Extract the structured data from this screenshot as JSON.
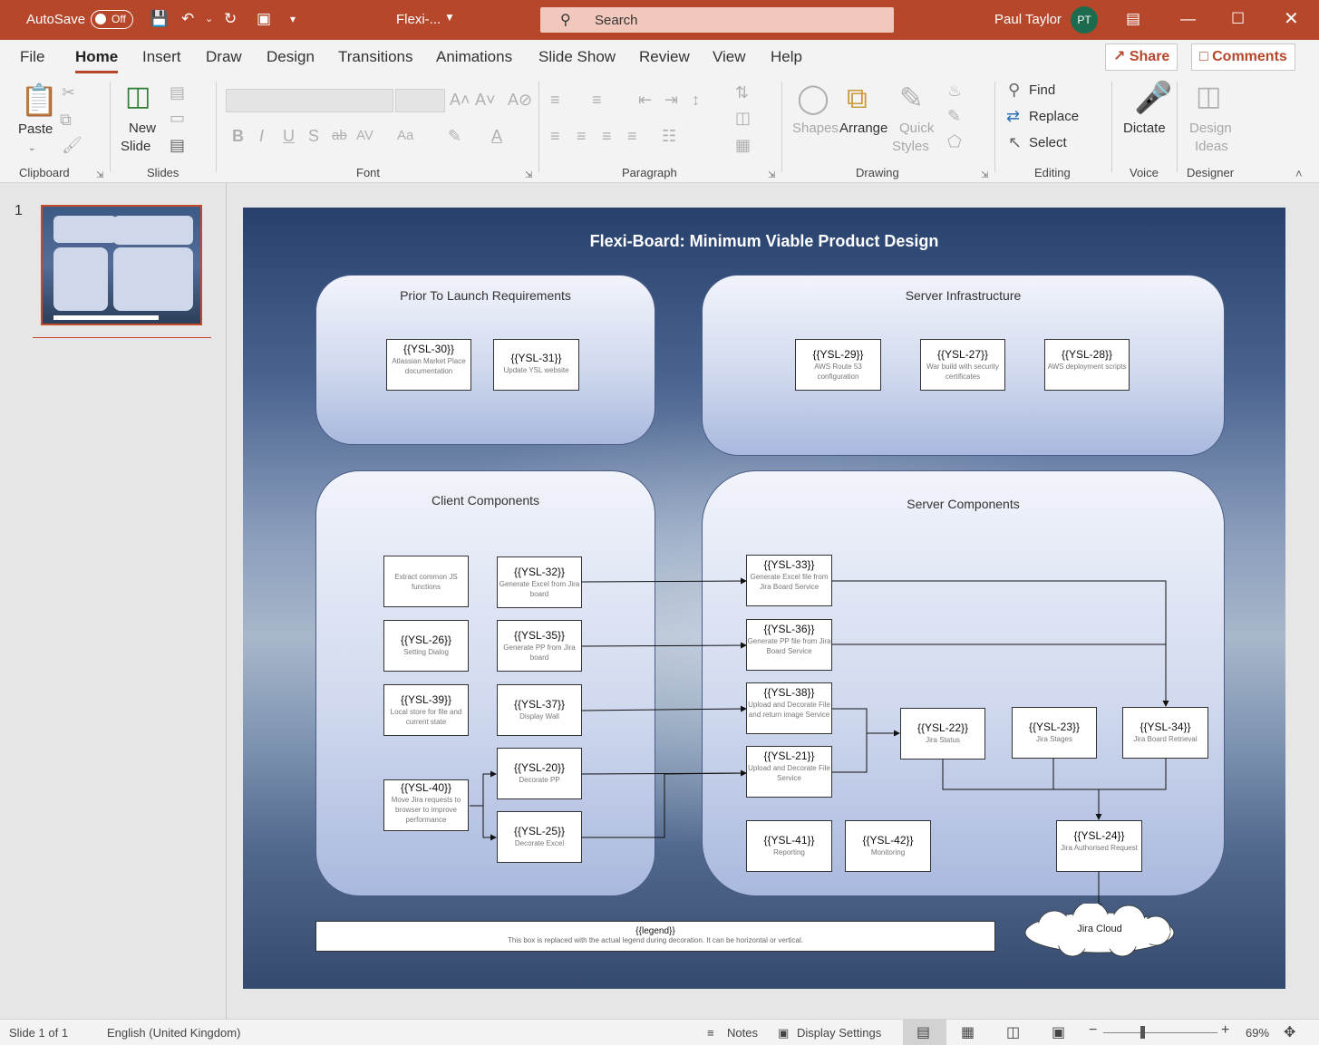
{
  "titlebar": {
    "autosave_label": "AutoSave",
    "autosave_state": "Off",
    "doc_title": "Flexi-...",
    "search_placeholder": "Search",
    "user_name": "Paul Taylor",
    "user_initials": "PT"
  },
  "menu": {
    "items": [
      "File",
      "Home",
      "Insert",
      "Draw",
      "Design",
      "Transitions",
      "Animations",
      "Slide Show",
      "Review",
      "View",
      "Help"
    ],
    "share_label": "Share",
    "comments_label": "Comments"
  },
  "ribbon": {
    "clipboard": {
      "paste": "Paste",
      "group": "Clipboard"
    },
    "slides": {
      "new_slide_1": "New",
      "new_slide_2": "Slide",
      "group": "Slides"
    },
    "font": {
      "group": "Font"
    },
    "paragraph": {
      "group": "Paragraph"
    },
    "drawing": {
      "shapes": "Shapes",
      "arrange": "Arrange",
      "quick_styles_1": "Quick",
      "quick_styles_2": "Styles",
      "group": "Drawing"
    },
    "editing": {
      "find": "Find",
      "replace": "Replace",
      "select": "Select",
      "group": "Editing"
    },
    "voice": {
      "dictate": "Dictate",
      "group": "Voice"
    },
    "designer": {
      "ideas_1": "Design",
      "ideas_2": "Ideas",
      "group": "Designer"
    }
  },
  "thumbnail": {
    "number": "1"
  },
  "slide": {
    "title": "Flexi-Board: Minimum Viable Product Design",
    "panels": {
      "prior": "Prior To Launch Requirements",
      "server_infra": "Server Infrastructure",
      "client": "Client Components",
      "server_comp": "Server Components"
    },
    "boxes": {
      "ysl30": {
        "id": "{{YSL-30}}",
        "desc": "Atlassian Market Place documentation"
      },
      "ysl31": {
        "id": "{{YSL-31}}",
        "desc": "Update YSL website"
      },
      "ysl29": {
        "id": "{{YSL-29}}",
        "desc": "AWS Route 53 configuration"
      },
      "ysl27": {
        "id": "{{YSL-27}}",
        "desc": "War build with security certificates"
      },
      "ysl28": {
        "id": "{{YSL-28}}",
        "desc": "AWS deployment scripts"
      },
      "extract": {
        "desc": "Extract common JS functions"
      },
      "ysl32": {
        "id": "{{YSL-32}}",
        "desc": "Generate Excel from Jira board"
      },
      "ysl26": {
        "id": "{{YSL-26}}",
        "desc": "Setting Dialog"
      },
      "ysl35": {
        "id": "{{YSL-35}}",
        "desc": "Generate PP from Jira board"
      },
      "ysl39": {
        "id": "{{YSL-39}}",
        "desc": "Local store for file and current state"
      },
      "ysl37": {
        "id": "{{YSL-37}}",
        "desc": "Display Wall"
      },
      "ysl40": {
        "id": "{{YSL-40}}",
        "desc": "Move Jira requests to browser to improve performance"
      },
      "ysl20": {
        "id": "{{YSL-20}}",
        "desc": "Decorate PP"
      },
      "ysl25": {
        "id": "{{YSL-25}}",
        "desc": "Decorate Excel"
      },
      "ysl33": {
        "id": "{{YSL-33}}",
        "desc": "Generate Excel file from Jira Board Service"
      },
      "ysl36": {
        "id": "{{YSL-36}}",
        "desc": "Generate PP file from Jira Board Service"
      },
      "ysl38": {
        "id": "{{YSL-38}}",
        "desc": "Upload and Decorate File and return image Service"
      },
      "ysl21": {
        "id": "{{YSL-21}}",
        "desc": "Upload and Decorate File Service"
      },
      "ysl22": {
        "id": "{{YSL-22}}",
        "desc": "Jira Status"
      },
      "ysl23": {
        "id": "{{YSL-23}}",
        "desc": "Jira Stages"
      },
      "ysl34": {
        "id": "{{YSL-34}}",
        "desc": "Jira Board Retrieval"
      },
      "ysl41": {
        "id": "{{YSL-41}}",
        "desc": "Reporting"
      },
      "ysl42": {
        "id": "{{YSL-42}}",
        "desc": "Monitoring"
      },
      "ysl24": {
        "id": "{{YSL-24}}",
        "desc": "Jira Authorised Request"
      }
    },
    "legend": {
      "title": "{{legend}}",
      "desc": "This box is replaced with the actual legend during decoration. It can be horizontal or vertical."
    },
    "cloud": "Jira Cloud"
  },
  "status": {
    "slide_info": "Slide 1 of 1",
    "language": "English (United Kingdom)",
    "notes": "Notes",
    "display_settings": "Display Settings",
    "zoom": "69%"
  }
}
